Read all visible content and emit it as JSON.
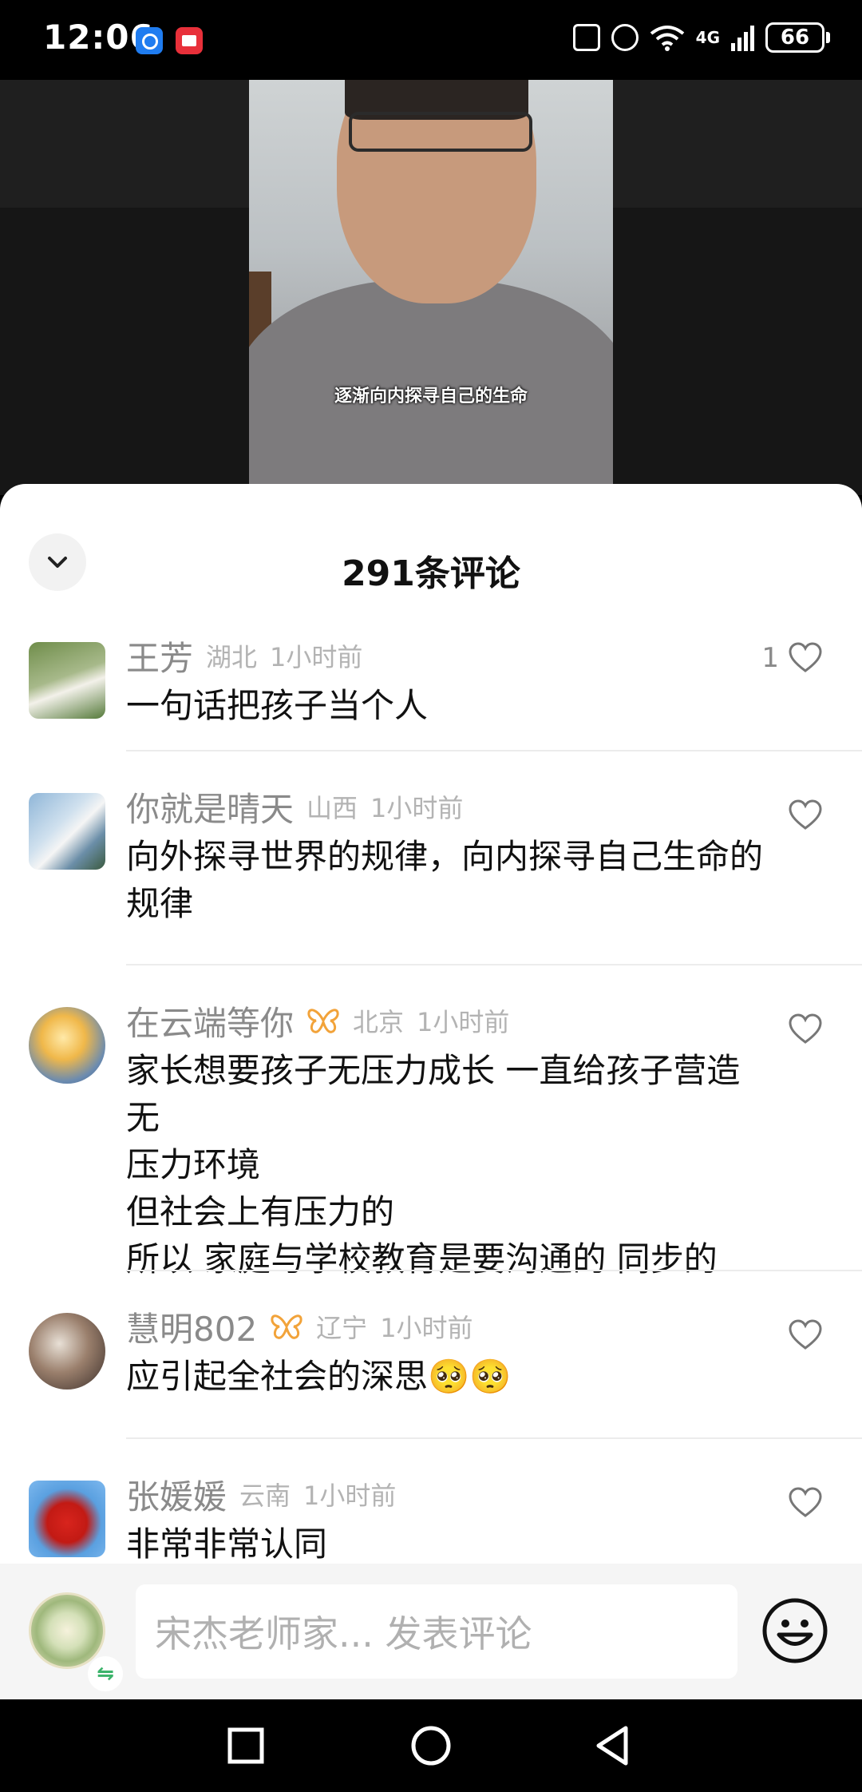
{
  "status_bar": {
    "time": "12:06",
    "network": "4G",
    "battery": "66"
  },
  "video": {
    "subtitle": "逐渐向内探寻自己的生命"
  },
  "comments_panel": {
    "title": "291条评论",
    "comments": [
      {
        "name": "王芳",
        "location": "湖北",
        "time": "1小时前",
        "lines": [
          "一句话把孩子当个人"
        ],
        "likes": "1",
        "badge": false
      },
      {
        "name": "你就是晴天",
        "location": "山西",
        "time": "1小时前",
        "lines": [
          "向外探寻世界的规律，向内探寻自己生命的",
          "规律"
        ],
        "likes": "",
        "badge": false
      },
      {
        "name": "在云端等你",
        "location": "北京",
        "time": "1小时前",
        "lines": [
          "家长想要孩子无压力成长 一直给孩子营造无",
          "压力环境",
          "但社会上有压力的",
          "所以 家庭与学校教育是要沟通的 同步的"
        ],
        "likes": "",
        "badge": true
      },
      {
        "name": "慧明802",
        "location": "辽宁",
        "time": "1小时前",
        "lines": [
          "应引起全社会的深思🥺🥺"
        ],
        "likes": "",
        "badge": true
      },
      {
        "name": "张媛媛",
        "location": "云南",
        "time": "1小时前",
        "lines": [
          "非常非常认同"
        ],
        "likes": "",
        "badge": false
      }
    ]
  },
  "input_bar": {
    "placeholder": "宋杰老师家... 发表评论",
    "switch_icon": "⇋"
  },
  "icons": {
    "collapse": "chevron-down-icon",
    "like": "heart-outline-icon",
    "badge": "butterfly-badge-icon",
    "emoji": "smiley-icon",
    "nav": [
      "square-recents-icon",
      "circle-home-icon",
      "triangle-back-icon"
    ]
  },
  "colors": {
    "accent_badge": "#f2a33a",
    "text_primary": "#111111",
    "text_secondary": "#8a8a8a"
  }
}
